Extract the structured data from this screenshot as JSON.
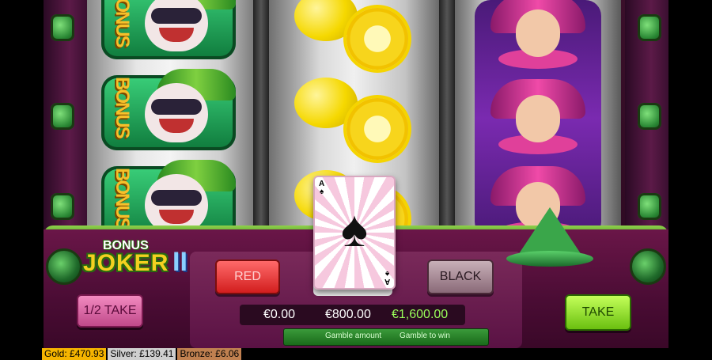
{
  "game": {
    "logo_top": "BONUS",
    "logo_main": "JOKER",
    "logo_suffix": "II"
  },
  "buttons": {
    "red": "RED",
    "black": "BLACK",
    "half_take": "1/2 TAKE",
    "take": "TAKE"
  },
  "amounts": {
    "bet": "€0.00",
    "gamble_amount": "€800.00",
    "gamble_to_win": "€1,600.00"
  },
  "labels": {
    "gamble_amount": "Gamble amount",
    "gamble_to_win": "Gamble to win"
  },
  "card": {
    "rank": "A",
    "suit": "♠"
  },
  "status": {
    "gold": "Gold: £470.93",
    "silver": "Silver: £139.41",
    "bronze": "Bronze: £6.06"
  },
  "reels": {
    "reel1_symbol_text": "BONUS"
  },
  "colors": {
    "red_button": "#d21e1e",
    "take_button": "#6ac010",
    "win_amount": "#9aff5a",
    "gold_jackpot": "#f5b400"
  }
}
